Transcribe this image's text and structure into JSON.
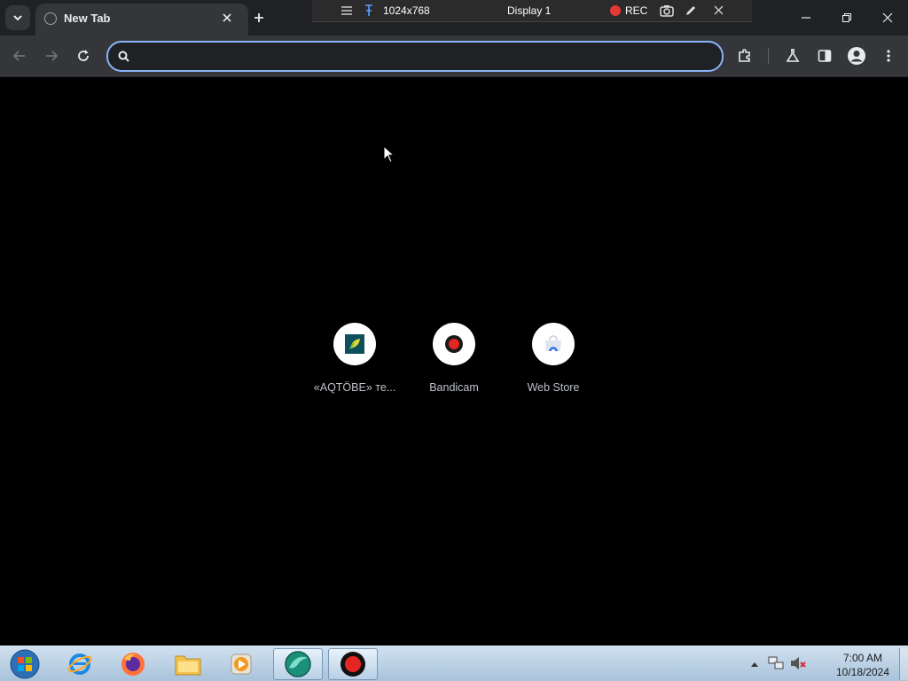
{
  "browser": {
    "tab": {
      "title": "New Tab"
    },
    "omnibox": {
      "value": "",
      "placeholder": ""
    }
  },
  "recorder": {
    "resolution": "1024x768",
    "display": "Display 1",
    "rec_label": "REC",
    "rec_color": "#e53935"
  },
  "shortcuts": [
    {
      "label": "«AQTÖBE» те...",
      "icon": "aqtobe-icon"
    },
    {
      "label": "Bandicam",
      "icon": "bandicam-icon"
    },
    {
      "label": "Web Store",
      "icon": "web-store-icon"
    }
  ],
  "taskbar": {
    "apps": [
      "windows-start-orb",
      "internet-explorer-icon",
      "firefox-icon",
      "file-explorer-icon",
      "media-player-icon",
      "browser-icon",
      "bandicam-icon"
    ],
    "clock": {
      "time": "7:00 AM",
      "date": "10/18/2024"
    }
  },
  "colors": {
    "accent": "#8ab4f8",
    "tabstrip": "#202124",
    "toolbar": "#35363a"
  }
}
